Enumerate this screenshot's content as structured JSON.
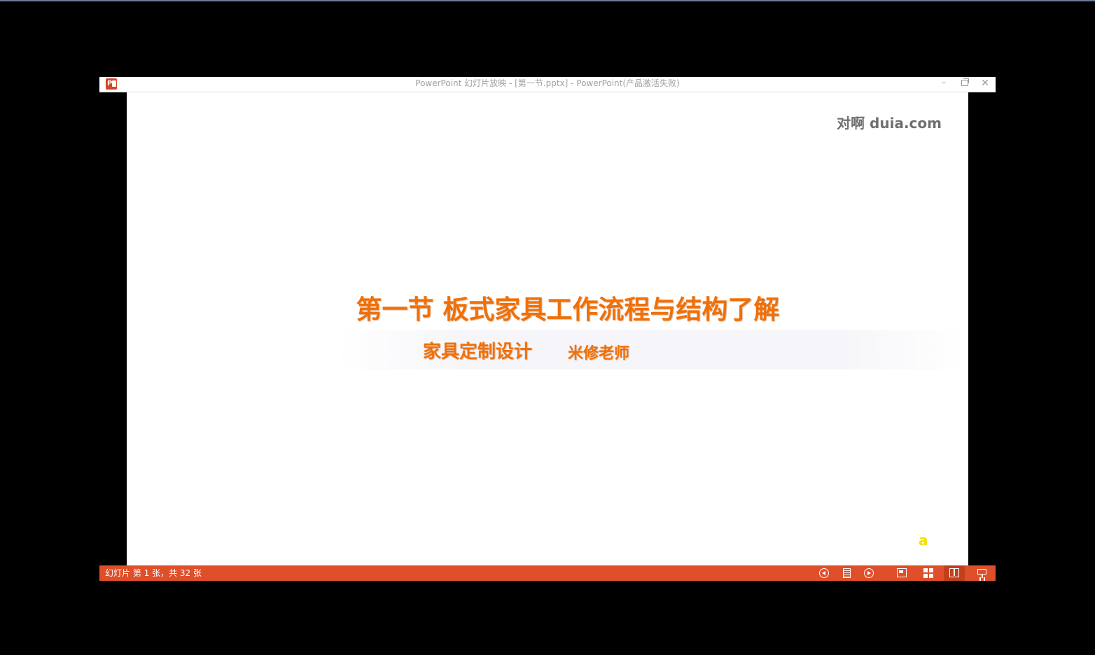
{
  "window": {
    "title": "PowerPoint 幻灯片放映 - [第一节.pptx] - PowerPoint(产品激活失败)",
    "app_icon": "powerpoint-icon",
    "controls": {
      "minimize": "–",
      "close": "✕"
    }
  },
  "slide": {
    "logo": "对啊 duia.com",
    "title": "第一节 板式家具工作流程与结构了解",
    "subtitle": "家具定制设计",
    "teacher": "米修老师",
    "corner_mark": "a",
    "title_color": "#f07008"
  },
  "status_bar": {
    "slide_info": "幻灯片 第 1 张，共 32 张",
    "background_color": "#de4f2a",
    "icons": [
      "previous-icon",
      "menu-icon",
      "next-icon",
      "normal-view-icon",
      "slide-sorter-icon",
      "reading-view-icon",
      "slide-show-icon"
    ]
  }
}
